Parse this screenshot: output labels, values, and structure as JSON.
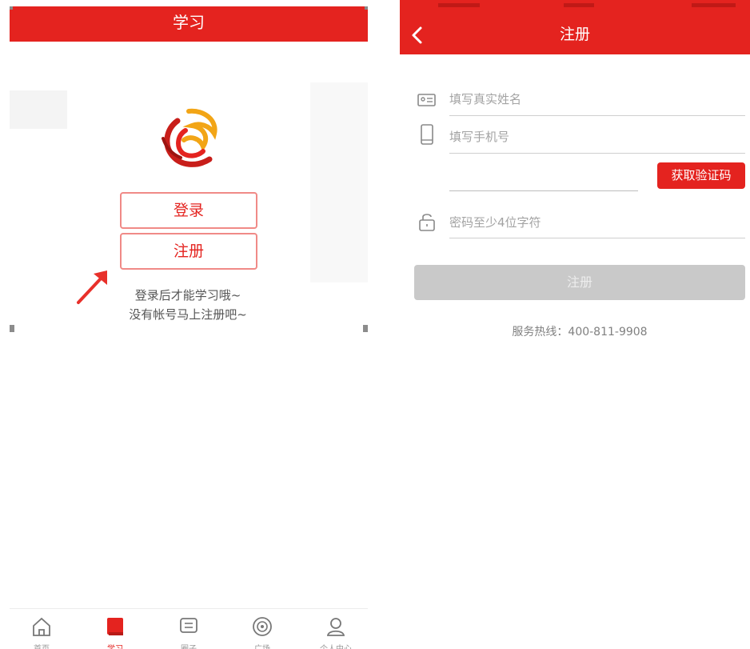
{
  "colors": {
    "brand_red": "#e4231f",
    "button_border": "#f08a87",
    "disabled_button": "#c9c9c9",
    "arrow": "#e8302a"
  },
  "study_page": {
    "title": "学习",
    "logo_icon": "phoenix-logo-icon",
    "login_label": "登录",
    "register_label": "注册",
    "hint_line1": "登录后才能学习哦~",
    "hint_line2": "没有帐号马上注册吧~",
    "tabbar": [
      {
        "label": "首页",
        "icon": "home-icon",
        "active": false
      },
      {
        "label": "学习",
        "icon": "book-icon",
        "active": true
      },
      {
        "label": "圈子",
        "icon": "chat-icon",
        "active": false
      },
      {
        "label": "广场",
        "icon": "radar-icon",
        "active": false
      },
      {
        "label": "个人中心",
        "icon": "user-icon",
        "active": false
      }
    ]
  },
  "register_page": {
    "title": "注册",
    "back_icon": "back-arrow-icon",
    "fields": {
      "name_placeholder": "填写真实姓名",
      "phone_placeholder": "填写手机号",
      "code_placeholder": "",
      "password_placeholder": "密码至少4位字符"
    },
    "get_code_label": "获取验证码",
    "submit_label": "注册",
    "hotline_label": "服务热线：",
    "hotline_number": "400-811-9908"
  }
}
